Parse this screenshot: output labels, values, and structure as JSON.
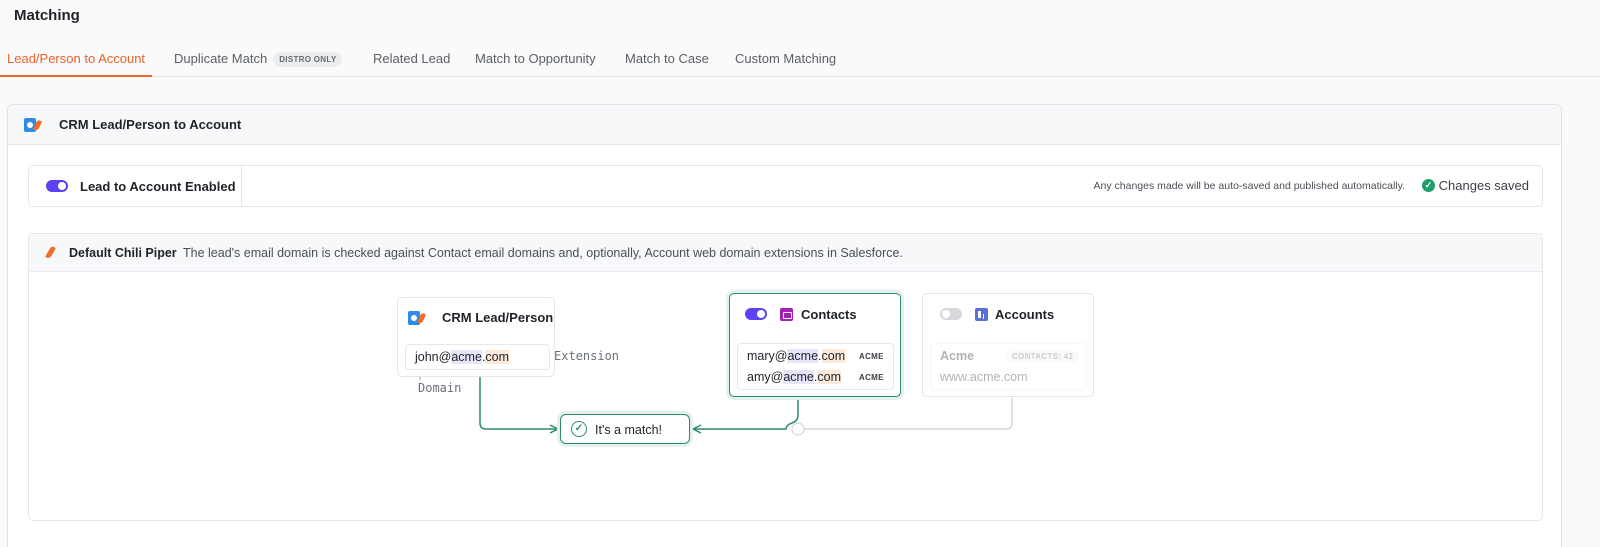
{
  "page": {
    "title": "Matching"
  },
  "tabs": [
    {
      "label": "Lead/Person to Account",
      "active": true
    },
    {
      "label": "Duplicate Match",
      "badge": "DISTRO ONLY"
    },
    {
      "label": "Related Lead"
    },
    {
      "label": "Match to Opportunity"
    },
    {
      "label": "Match to Case"
    },
    {
      "label": "Custom Matching"
    }
  ],
  "section": {
    "title": "CRM Lead/Person to Account"
  },
  "enable": {
    "label": "Lead to Account Enabled",
    "enabled": true,
    "autosave_note": "Any changes made will be auto-saved and published automatically.",
    "saved_status": "Changes saved"
  },
  "method": {
    "title": "Default Chili Piper",
    "description": "The lead's email domain is checked against Contact email domains and, optionally, Account web domain extensions in Salesforce."
  },
  "diagram": {
    "lead_node": {
      "title": "CRM Lead/Person",
      "email_user": "john@",
      "email_domain": "acme",
      "email_dot": ".",
      "email_ext": "com",
      "domain_label": "Domain",
      "extension_label": "Extension"
    },
    "contacts_node": {
      "title": "Contacts",
      "enabled": true,
      "rows": [
        {
          "user": "mary@",
          "domain": "acme",
          "dot": ".",
          "ext": "com",
          "tag": "ACME"
        },
        {
          "user": "amy@",
          "domain": "acme",
          "dot": ".",
          "ext": "com",
          "tag": "ACME"
        }
      ]
    },
    "accounts_node": {
      "title": "Accounts",
      "enabled": false,
      "account_name": "Acme",
      "contacts_badge": "CONTACTS: 41",
      "website": "www.acme.com"
    },
    "result": {
      "label": "It's a match!"
    }
  },
  "colors": {
    "accent": "#e8642a",
    "toggle_on": "#5b42f3",
    "match_green": "#2e8b68",
    "saved_green": "#1f9d6b"
  }
}
